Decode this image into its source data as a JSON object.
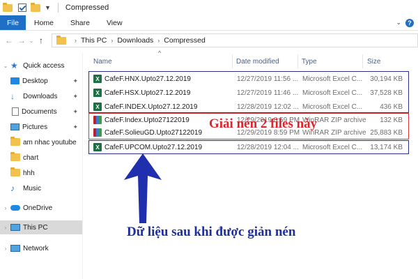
{
  "window": {
    "title": "Compressed"
  },
  "ribbon": {
    "tabs": [
      "File",
      "Home",
      "Share",
      "View"
    ]
  },
  "address": {
    "crumbs": [
      "This PC",
      "Downloads",
      "Compressed"
    ]
  },
  "sidebar": {
    "items": [
      {
        "label": "Quick access",
        "icon": "star-icon",
        "pinned": false
      },
      {
        "label": "Desktop",
        "icon": "desktop-icon",
        "pinned": true
      },
      {
        "label": "Downloads",
        "icon": "download-icon",
        "pinned": true
      },
      {
        "label": "Documents",
        "icon": "document-icon",
        "pinned": true
      },
      {
        "label": "Pictures",
        "icon": "pictures-icon",
        "pinned": true
      },
      {
        "label": "am nhac youtube",
        "icon": "folder-icon",
        "pinned": false
      },
      {
        "label": "chart",
        "icon": "folder-icon",
        "pinned": false
      },
      {
        "label": "hhh",
        "icon": "folder-icon",
        "pinned": false
      },
      {
        "label": "Music",
        "icon": "music-icon",
        "pinned": false
      },
      {
        "label": "OneDrive",
        "icon": "cloud-icon",
        "pinned": false
      },
      {
        "label": "This PC",
        "icon": "computer-icon",
        "pinned": false
      },
      {
        "label": "Network",
        "icon": "network-icon",
        "pinned": false
      }
    ]
  },
  "columns": {
    "name": "Name",
    "date": "Date modified",
    "type": "Type",
    "size": "Size"
  },
  "files": [
    {
      "name": "CafeF.HNX.Upto27.12.2019",
      "date": "12/27/2019 11:56 ...",
      "type": "Microsoft Excel C...",
      "size": "30,194 KB",
      "kind": "excel"
    },
    {
      "name": "CafeF.HSX.Upto27.12.2019",
      "date": "12/27/2019 11:46 ...",
      "type": "Microsoft Excel C...",
      "size": "37,528 KB",
      "kind": "excel"
    },
    {
      "name": "CafeF.INDEX.Upto27.12.2019",
      "date": "12/28/2019 12:02 ...",
      "type": "Microsoft Excel C...",
      "size": "436 KB",
      "kind": "excel"
    },
    {
      "name": "CafeF.Index.Upto27122019",
      "date": "12/29/2019 8:59 PM",
      "type": "WinRAR ZIP archive",
      "size": "132 KB",
      "kind": "rar"
    },
    {
      "name": "CafeF.SolieuGD.Upto27122019",
      "date": "12/29/2019 8:59 PM",
      "type": "WinRAR ZIP archive",
      "size": "25,883 KB",
      "kind": "rar"
    },
    {
      "name": "CafeF.UPCOM.Upto27.12.2019",
      "date": "12/28/2019 12:04 ...",
      "type": "Microsoft Excel C...",
      "size": "13,174 KB",
      "kind": "excel"
    }
  ],
  "annotations": {
    "red_text": "Giải nén 2 files này",
    "blue_text": "Dữ liệu sau khi được giản nén",
    "red_color": "#e0242b",
    "blue_color": "#1f2f9e"
  }
}
